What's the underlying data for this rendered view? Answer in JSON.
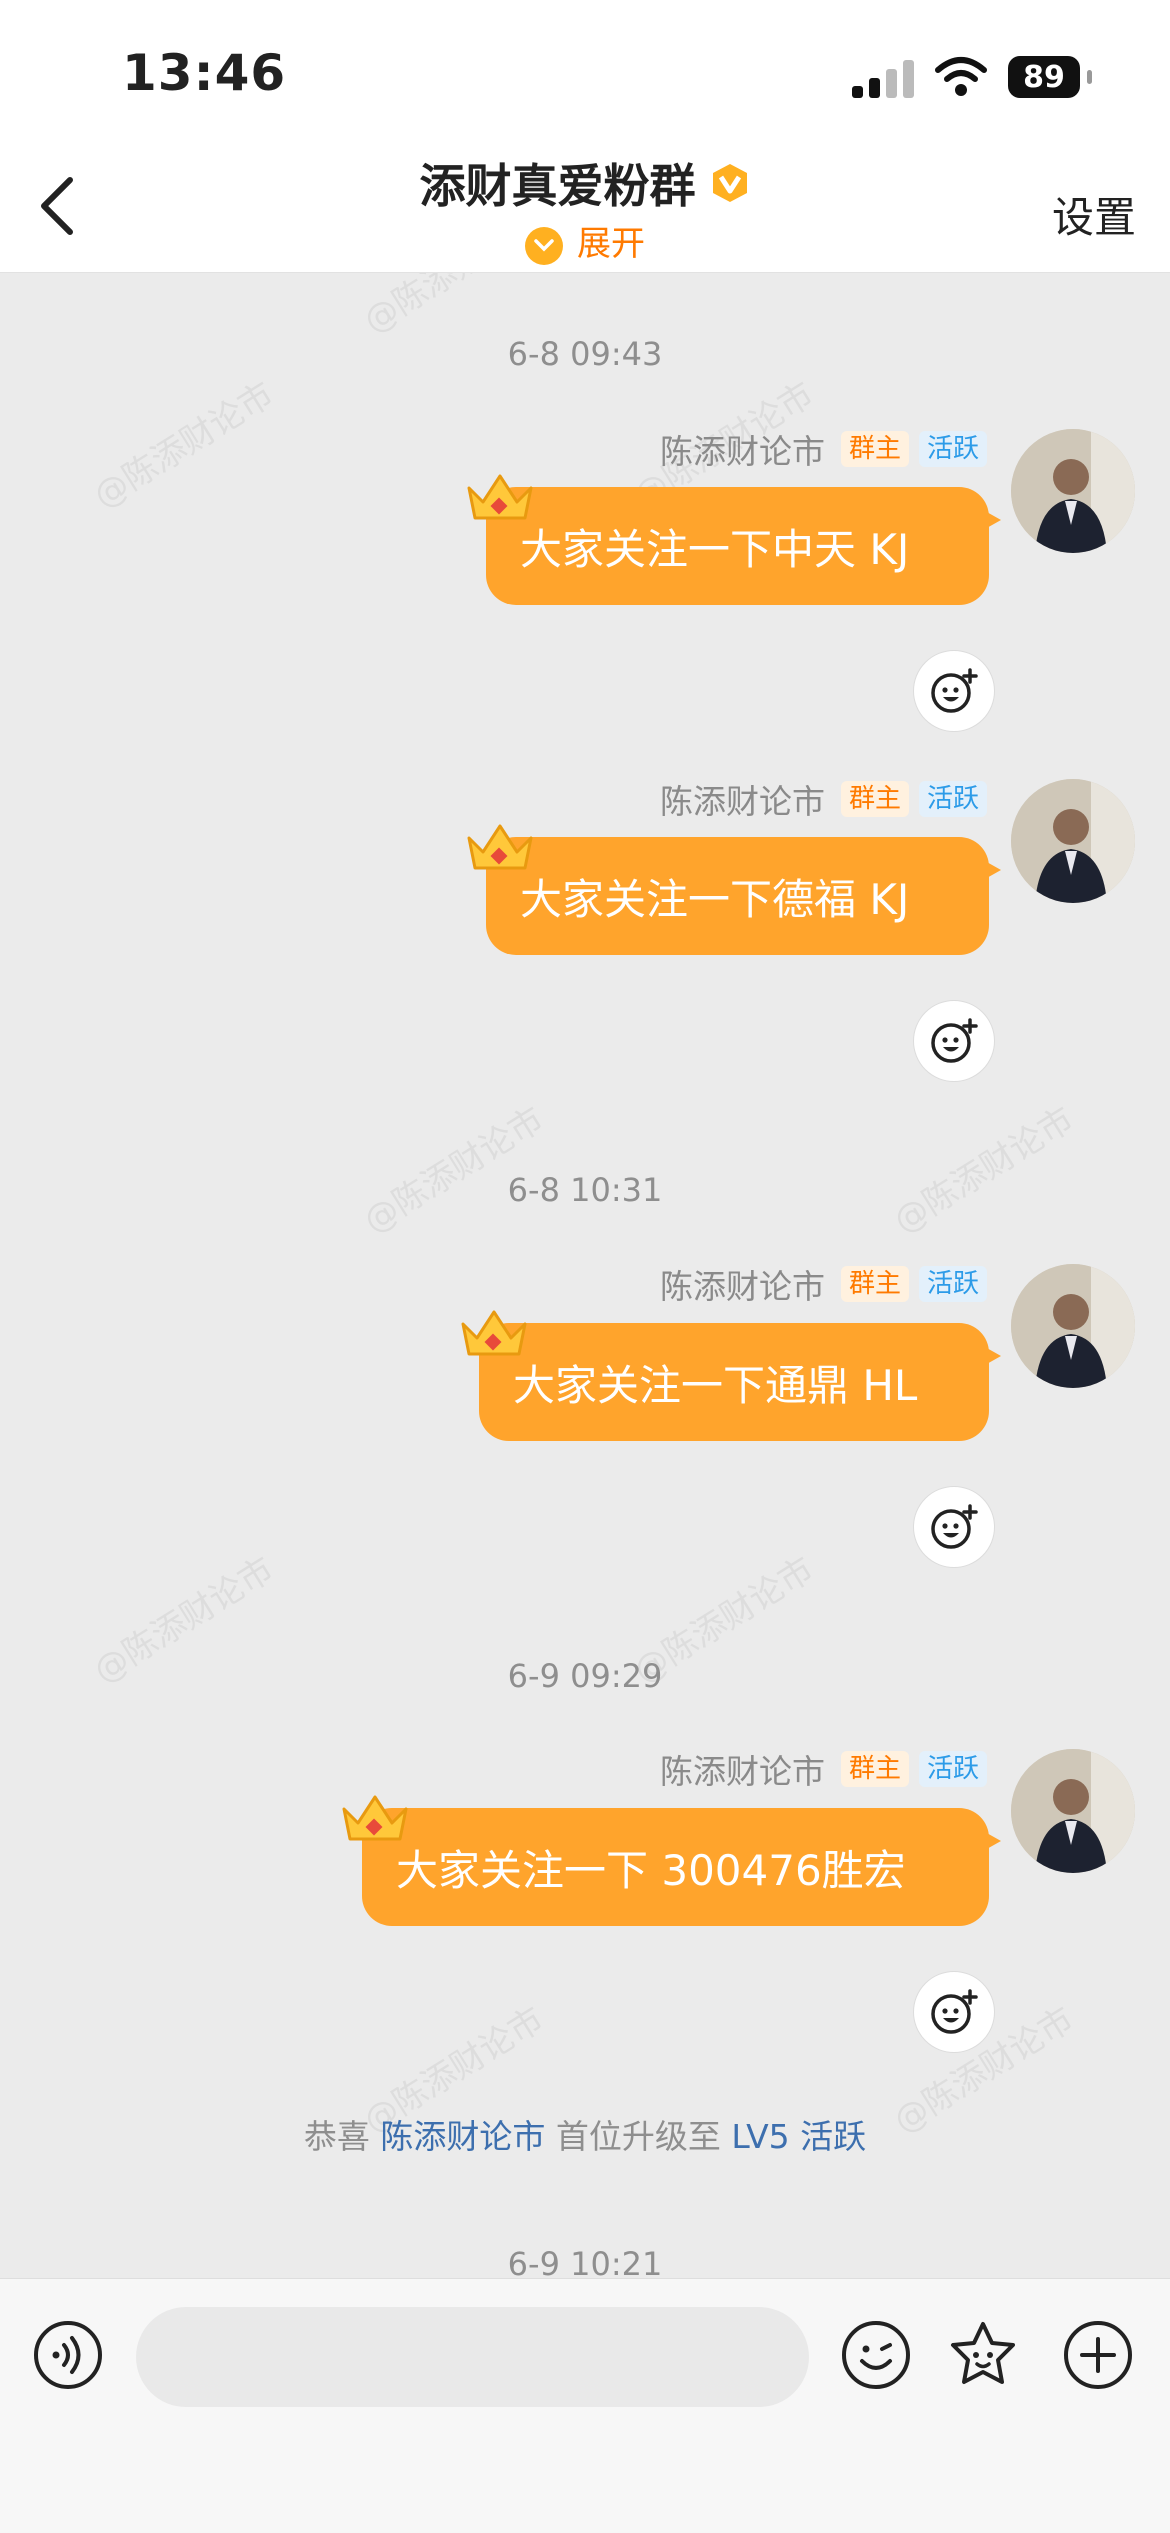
{
  "status_bar": {
    "time": "13:46",
    "battery": "89"
  },
  "header": {
    "title": "添财真爱粉群",
    "expand_label": "展开",
    "settings_label": "设置"
  },
  "watermark_text": "@陈添财论市",
  "messages": [
    {
      "timestamp": "6-8 09:43",
      "sender": "陈添财论市",
      "badge_owner": "群主",
      "badge_active": "活跃",
      "text": "大家关注一下中天 KJ"
    },
    {
      "sender": "陈添财论市",
      "badge_owner": "群主",
      "badge_active": "活跃",
      "text": "大家关注一下德福 KJ"
    },
    {
      "timestamp": "6-8 10:31",
      "sender": "陈添财论市",
      "badge_owner": "群主",
      "badge_active": "活跃",
      "text": "大家关注一下通鼎 HL"
    },
    {
      "timestamp": "6-9 09:29",
      "sender": "陈添财论市",
      "badge_owner": "群主",
      "badge_active": "活跃",
      "text": "大家关注一下 300476胜宏"
    }
  ],
  "system_message": {
    "prefix": "恭喜",
    "user": "陈添财论市",
    "middle": "首位升级至",
    "level": "LV5 活跃"
  },
  "last_timestamp": "6-9 10:21",
  "input_bar": {
    "placeholder": ""
  },
  "colors": {
    "bubble": "#ffa42c",
    "accent": "#ff7a00",
    "badge_active": "#2c9be8",
    "link": "#3d6fae"
  },
  "icons": [
    "back-chevron-icon",
    "verified-v-icon",
    "expand-chevron-icon",
    "crown-icon",
    "emoji-react-icon",
    "voice-icon",
    "emoji-icon",
    "sticker-icon",
    "plus-icon"
  ]
}
